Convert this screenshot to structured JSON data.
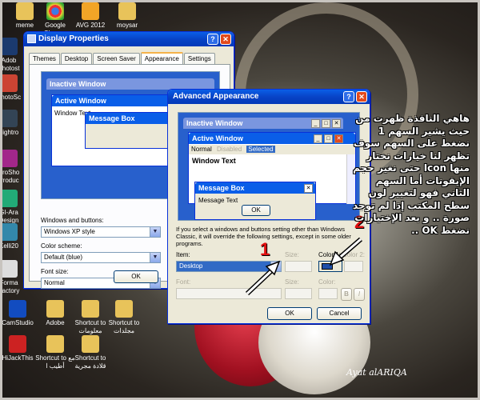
{
  "desktop": {
    "top_icons": [
      "meme",
      "Google Chrome",
      "AVG 2012",
      "moysar"
    ],
    "left_icons": [
      "Adob Photost",
      "PhotoSc",
      "Lightro",
      "ProSho Produc",
      "GI-Ara Design",
      "Kelli20",
      "Forma Factory",
      "CamStudio",
      "HiJackThis"
    ],
    "bottom_icons": [
      "Adobe",
      "Shortcut to معلومات",
      "Shortcut to مجلدات",
      "Shortcut to مع أطيب ا",
      "Shortcut to قلادة مجرية"
    ]
  },
  "display_properties": {
    "title": "Display Properties",
    "tabs": [
      "Themes",
      "Desktop",
      "Screen Saver",
      "Appearance",
      "Settings"
    ],
    "inactive_window": "Inactive Window",
    "active_window": "Active Window",
    "window_text": "Window Text",
    "message_box": "Message Box",
    "windows_buttons_label": "Windows and buttons:",
    "windows_buttons_value": "Windows XP style",
    "color_scheme_label": "Color scheme:",
    "color_scheme_value": "Default (blue)",
    "font_size_label": "Font size:",
    "font_size_value": "Normal",
    "ok": "OK"
  },
  "advanced_appearance": {
    "title": "Advanced Appearance",
    "inactive_window": "Inactive Window",
    "active_window": "Active Window",
    "menu": [
      "Normal",
      "Disabled",
      "Selected"
    ],
    "window_text": "Window Text",
    "message_box": "Message Box",
    "message_text": "Message Text",
    "ok_preview": "OK",
    "info": "If you select a windows and buttons setting other than Windows Classic, it will override the following settings, except in some older programs.",
    "item_label": "Item:",
    "item_value": "Desktop",
    "size_label": "Size:",
    "color1_label": "Color 1:",
    "color2_label": "Color 2:",
    "font_label": "Font:",
    "font_size_label": "Size:",
    "font_color_label": "Color:",
    "bold": "B",
    "italic": "I",
    "ok": "OK",
    "cancel": "Cancel"
  },
  "annotations": {
    "number_1": "1",
    "number_2": "2",
    "arabic_text": "هاهي النافذة ظهرت من حيث يشير السهم 1 نضغط على السهم سوف تظهر لنا خيارات نختار منها Icon حتى نغير حجم الإيقونات أما السهم الثاني فهو لتغيير لون سطح المكتب إذا لم توجد صورة .. و بعد الإختيارات نضغط OK ..",
    "signature": "Ayat alARIQA"
  },
  "colors": {
    "xp_blue": "#0a5ee8",
    "desktop_swatch": "#1f4ea8",
    "accent_red": "#e01010"
  }
}
